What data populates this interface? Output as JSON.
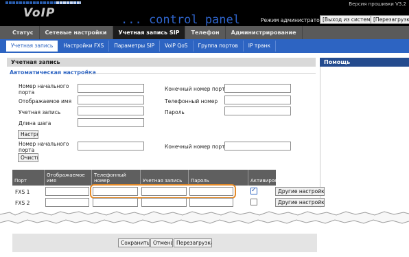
{
  "header": {
    "logo": "VoIP",
    "subtitle": "... control panel",
    "firmware_version": "Версия прошивки V3.2",
    "mode_label": "Режим администратора",
    "logout_button": "[Выход из системы]",
    "reboot_button": "[Перезагрузка]"
  },
  "main_tabs": [
    {
      "label": "Статус",
      "active": false
    },
    {
      "label": "Сетевые настройки",
      "active": false
    },
    {
      "label": "Учетная запись SIP",
      "active": true
    },
    {
      "label": "Телефон",
      "active": false
    },
    {
      "label": "Администрирование",
      "active": false
    }
  ],
  "sub_tabs": [
    {
      "label": "Учетная запись",
      "active": true
    },
    {
      "label": "Настройки FXS",
      "active": false
    },
    {
      "label": "Параметры SIP",
      "active": false
    },
    {
      "label": "VoIP QoS",
      "active": false
    },
    {
      "label": "Группа портов",
      "active": false
    },
    {
      "label": "IP транк",
      "active": false
    }
  ],
  "section_title": "Учетная запись",
  "help_title": "Помощь",
  "auto_config": {
    "title": "Автоматическая настройка",
    "start_port_label": "Номер начального порта",
    "end_port_label": "Конечный номер порта",
    "display_name_label": "Отображаемое имя",
    "phone_number_label": "Телефонный номер",
    "account_label": "Учетная запись",
    "password_label": "Пароль",
    "step_label": "Длина шага",
    "configure_button": "Настройка",
    "start_port_label_2": "Номер начального порта",
    "end_port_label_2": "Конечный номер порта",
    "clear_button": "Очистить"
  },
  "port_table": {
    "headers": [
      "Порт",
      "Отображаемое имя",
      "Телефонный номер",
      "Учетная запись",
      "Пароль",
      "Активировать"
    ],
    "rows": [
      {
        "port": "FXS 1",
        "active": true,
        "more_button": "Другие настройки"
      },
      {
        "port": "FXS 2",
        "active": false,
        "more_button": "Другие настройки"
      }
    ]
  },
  "footer": {
    "save_button": "Сохранить",
    "cancel_button": "Отмена",
    "reboot_button": "Перезагрузка"
  },
  "colors": {
    "header_bg": "#000000",
    "accent_blue": "#2d64c2",
    "highlight": "#e38a2a"
  }
}
